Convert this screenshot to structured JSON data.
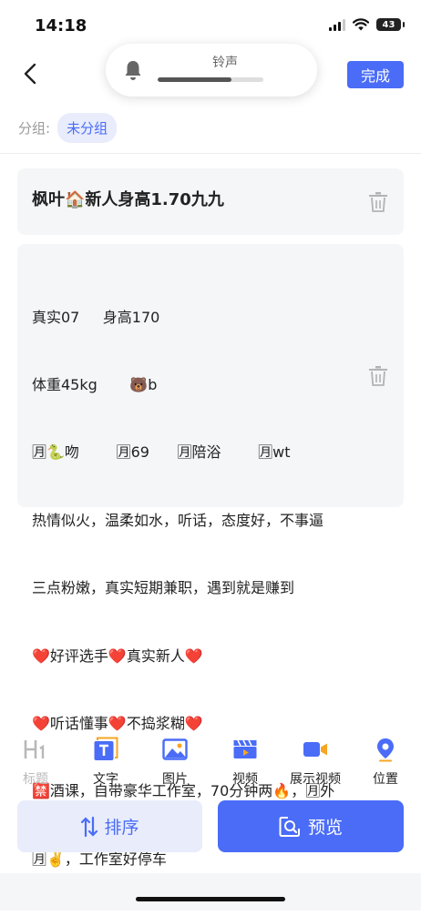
{
  "status_bar": {
    "time": "14:18",
    "battery": "43"
  },
  "ringtone": {
    "label": "铃声",
    "volume_fraction": 0.7
  },
  "header": {
    "done_label": "完成"
  },
  "group": {
    "label": "分组:",
    "value": "未分组"
  },
  "title_card": {
    "text": "枫叶🏠新人身高1.70九九"
  },
  "text_card": {
    "lines": [
      "真实07     身高170",
      "体重45kg       🐻b",
      "🈷🐍吻        🈷69      🈷陪浴        🈷wt",
      "热情似火，温柔如水，听话，态度好，不事逼",
      "三点粉嫩，真实短期兼职，遇到就是赚到",
      "❤️好评选手❤️真实新人❤️",
      "❤️听话懂事❤️不捣浆糊❤️",
      "🈲酒课，自带豪华工作室，70分钟两🔥，🈷外",
      "🈷✌️，工作室好停车"
    ]
  },
  "toolbar": {
    "tools": [
      {
        "label": "标题",
        "icon": "heading-icon",
        "enabled": false
      },
      {
        "label": "文字",
        "icon": "text-icon",
        "enabled": true
      },
      {
        "label": "图片",
        "icon": "image-icon",
        "enabled": true
      },
      {
        "label": "视频",
        "icon": "video-clapper-icon",
        "enabled": true
      },
      {
        "label": "展示视频",
        "icon": "video-camera-icon",
        "enabled": true
      },
      {
        "label": "位置",
        "icon": "location-pin-icon",
        "enabled": true
      }
    ]
  },
  "actions": {
    "sort_label": "排序",
    "preview_label": "预览"
  },
  "colors": {
    "accent": "#4a6cf7",
    "accent_light": "#e8ecfb",
    "card_bg": "#f5f6f8"
  }
}
